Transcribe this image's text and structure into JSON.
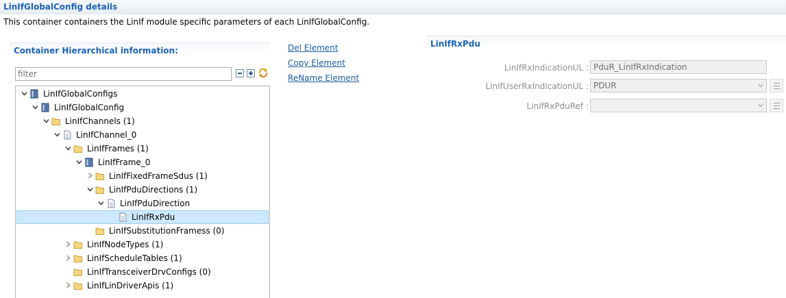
{
  "header": {
    "title": "LinIfGlobalConfig details",
    "description": "This container containers the LinIf module specific parameters of each LinIfGlobalConfig."
  },
  "left_panel": {
    "title": "Container Hierarchical information:",
    "filter_placeholder": "filter",
    "tree": [
      {
        "label": "LinIfGlobalConfigs",
        "icon": "container-icon",
        "expanded": true
      },
      {
        "label": "LinIfGlobalConfig",
        "icon": "container-icon",
        "expanded": true
      },
      {
        "label": "LinIfChannels (1)",
        "icon": "folder-icon",
        "expanded": true
      },
      {
        "label": "LinIfChannel_0",
        "icon": "document-icon",
        "expanded": true
      },
      {
        "label": "LinIfFrames (1)",
        "icon": "folder-icon",
        "expanded": true
      },
      {
        "label": "LinIfFrame_0",
        "icon": "container-icon",
        "expanded": true
      },
      {
        "label": "LinIfFixedFrameSdus (1)",
        "icon": "folder-icon",
        "expanded": false
      },
      {
        "label": "LinIfPduDirections (1)",
        "icon": "folder-icon",
        "expanded": true
      },
      {
        "label": "LinIfPduDirection",
        "icon": "document-icon",
        "expanded": true
      },
      {
        "label": "LinIfRxPdu",
        "icon": "document-icon",
        "selected": true
      },
      {
        "label": "LinIfSubstitutionFramess (0)",
        "icon": "folder-icon"
      },
      {
        "label": "LinIfNodeTypes (1)",
        "icon": "folder-icon",
        "expanded": false
      },
      {
        "label": "LinIfScheduleTables (1)",
        "icon": "folder-icon",
        "expanded": false
      },
      {
        "label": "LinIfTransceiverDrvConfigs (0)",
        "icon": "folder-icon"
      },
      {
        "label": "LinIfLinDriverApis (1)",
        "icon": "folder-icon",
        "expanded": false
      }
    ]
  },
  "actions": {
    "delete": "Del Element",
    "copy": "Copy Element",
    "rename": "ReName Element"
  },
  "right_panel": {
    "title": "LinIfRxPdu",
    "fields": [
      {
        "label": "LinIfRxIndicationUL :",
        "value": "PduR_LinIfRxIndication"
      },
      {
        "label": "LinIfUserRxIndicationUL :",
        "value": "PDUR"
      },
      {
        "label": "LinIfRxPduRef :",
        "value": ""
      }
    ]
  },
  "colors": {
    "accent": "#1d64b4",
    "link": "#1a5a9f",
    "selection": "#cde8fb"
  }
}
